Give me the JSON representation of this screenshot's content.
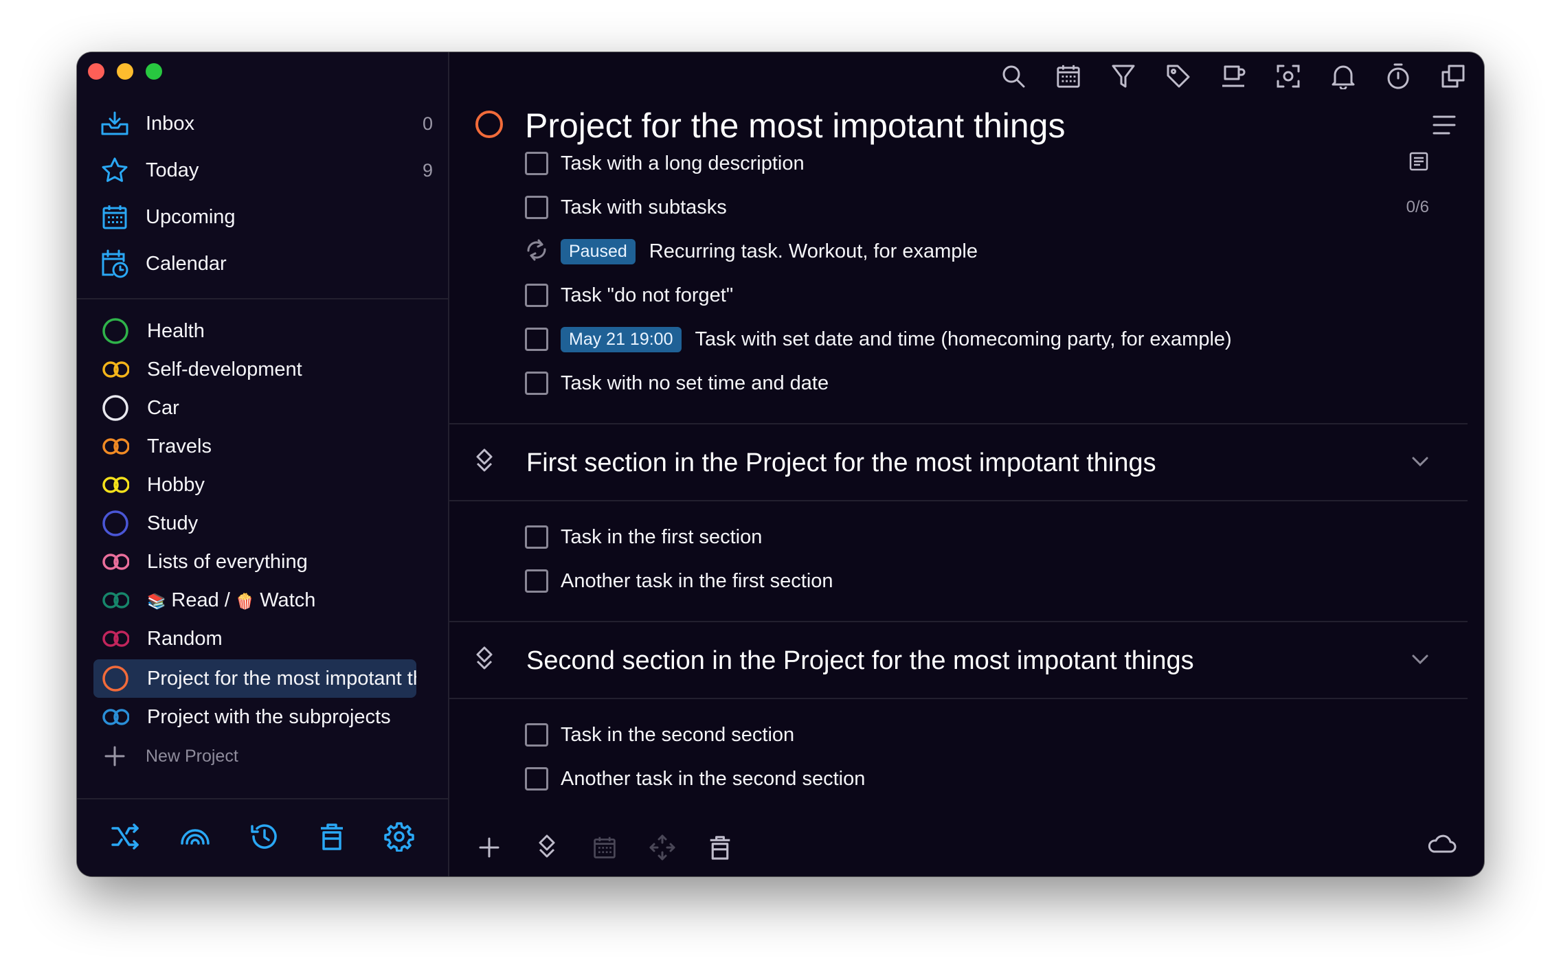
{
  "sidebar": {
    "nav": [
      {
        "label": "Inbox",
        "count": "0",
        "icon": "inbox-icon"
      },
      {
        "label": "Today",
        "count": "9",
        "icon": "star-icon"
      },
      {
        "label": "Upcoming",
        "count": "",
        "icon": "calendar-grid-icon"
      },
      {
        "label": "Calendar",
        "count": "",
        "icon": "calendar-clock-icon"
      }
    ],
    "projects": [
      {
        "label": "Health",
        "color": "#2fb34a"
      },
      {
        "label": "Self-development",
        "color": "#f3b51a"
      },
      {
        "label": "Car",
        "color": "#e8e8ee"
      },
      {
        "label": "Travels",
        "color": "#f08a24"
      },
      {
        "label": "Hobby",
        "color": "#f5e21b"
      },
      {
        "label": "Study",
        "color": "#4a56d6"
      },
      {
        "label": "Lists of everything",
        "color": "#ea6f9c"
      },
      {
        "label_a": "Read /",
        "label_b": "Watch",
        "emoji_a": "📚",
        "emoji_b": "🍿",
        "color": "#17866b"
      },
      {
        "label": "Random",
        "color": "#c2255c"
      },
      {
        "label": "Project for the most impotant things",
        "color": "#f26b3a"
      },
      {
        "label": "Project with the subprojects",
        "color": "#2a8fd8"
      }
    ],
    "new_project": "New Project",
    "bottom_icons": [
      "shuffle-icon",
      "rainbow-icon",
      "history-icon",
      "trash-icon",
      "gear-icon"
    ]
  },
  "toolbar": {
    "icons": [
      "search-icon",
      "calendar-icon",
      "filter-icon",
      "tag-icon",
      "coffee-icon",
      "focus-icon",
      "bell-icon",
      "timer-icon",
      "copy-icon"
    ]
  },
  "main": {
    "title": "Project for the most impotant things",
    "tasks": [
      {
        "label": "Task with a long description"
      },
      {
        "label": "Task with subtasks",
        "meta": "0/6"
      },
      {
        "label": "Recurring task. Workout, for example",
        "badge": "Paused"
      },
      {
        "label": "Task \"do not forget\""
      },
      {
        "label": "Task with set date and time (homecoming party, for example)",
        "badge": "May 21 19:00"
      },
      {
        "label": "Task with no set time and date"
      }
    ],
    "sections": [
      {
        "title": "First section in the Project for the most impotant things",
        "tasks": [
          "Task in the first section",
          "Another task in the first section"
        ]
      },
      {
        "title": "Second section in the Project for the most impotant things",
        "tasks": [
          "Task in the second section",
          "Another task in the second section"
        ]
      }
    ],
    "bottom_icons": [
      "add-icon",
      "section-icon",
      "calendar-icon",
      "move-icon",
      "trash-icon",
      "cloud-icon"
    ]
  },
  "colors": {
    "accent": "#2aa8f5",
    "badge": "#1f6196",
    "bg": "#0b0718"
  }
}
